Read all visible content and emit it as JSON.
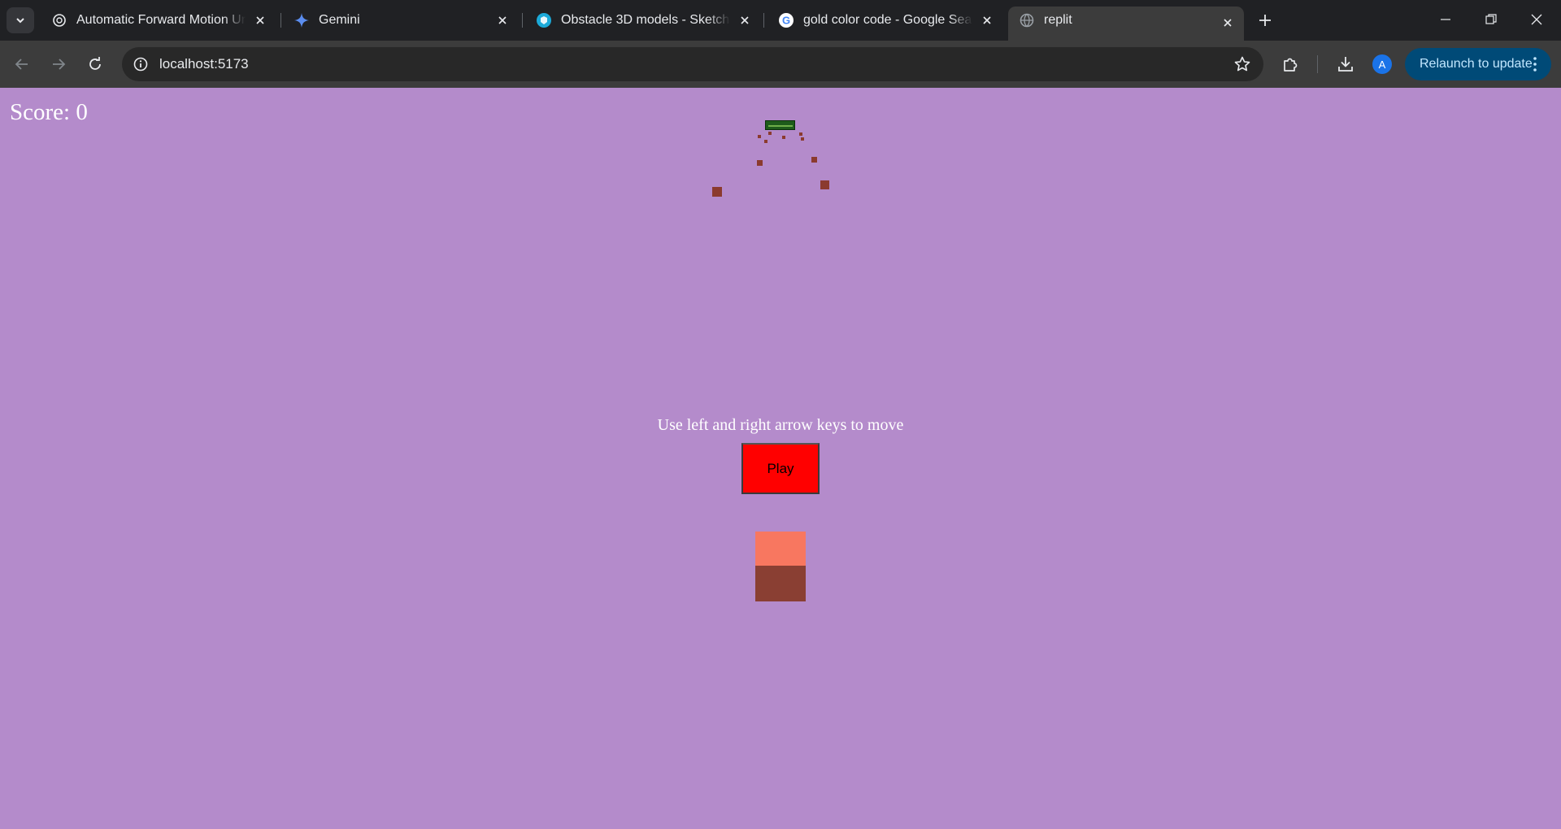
{
  "browser": {
    "tabs": [
      {
        "title": "Automatic Forward Motion Unit",
        "icon": "openai-icon",
        "active": false
      },
      {
        "title": "Gemini",
        "icon": "gemini-sparkle-icon",
        "active": false
      },
      {
        "title": "Obstacle 3D models - Sketchfab",
        "icon": "sketchfab-icon",
        "active": false
      },
      {
        "title": "gold color code - Google Search",
        "icon": "google-icon",
        "active": false
      },
      {
        "title": "replit",
        "icon": "globe-icon",
        "active": true
      }
    ],
    "url": "localhost:5173",
    "profile_initial": "A",
    "relaunch_label": "Relaunch to update"
  },
  "game": {
    "score_text": "Score: 0",
    "instructions": "Use left and right arrow keys to move",
    "play_label": "Play",
    "colors": {
      "background": "#b48bcb",
      "play_button": "#ff0000",
      "player_top": "#f87760",
      "player_front": "#8a3f33",
      "obstacle": "#8b3a2e",
      "goal": "#1e5b1b"
    }
  }
}
